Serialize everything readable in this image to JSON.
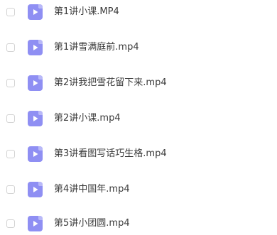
{
  "files": [
    {
      "name": "第1讲小课.MP4",
      "icon": "video-file-icon",
      "checked": false
    },
    {
      "name": "第1讲雪满庭前.mp4",
      "icon": "video-file-icon",
      "checked": false
    },
    {
      "name": "第2讲我把雪花留下来.mp4",
      "icon": "video-file-icon",
      "checked": false
    },
    {
      "name": "第2讲小课.mp4",
      "icon": "video-file-icon",
      "checked": false
    },
    {
      "name": "第3讲看图写话巧生格.mp4",
      "icon": "video-file-icon",
      "checked": false
    },
    {
      "name": "第4讲中国年.mp4",
      "icon": "video-file-icon",
      "checked": false
    },
    {
      "name": "第5讲小团圆.mp4",
      "icon": "video-file-icon",
      "checked": false
    }
  ],
  "colors": {
    "icon_bg": "#8f8ff3",
    "icon_fold": "#b9b9f8",
    "text": "#3a3a3a",
    "checkbox_border": "#d3d3d3"
  }
}
